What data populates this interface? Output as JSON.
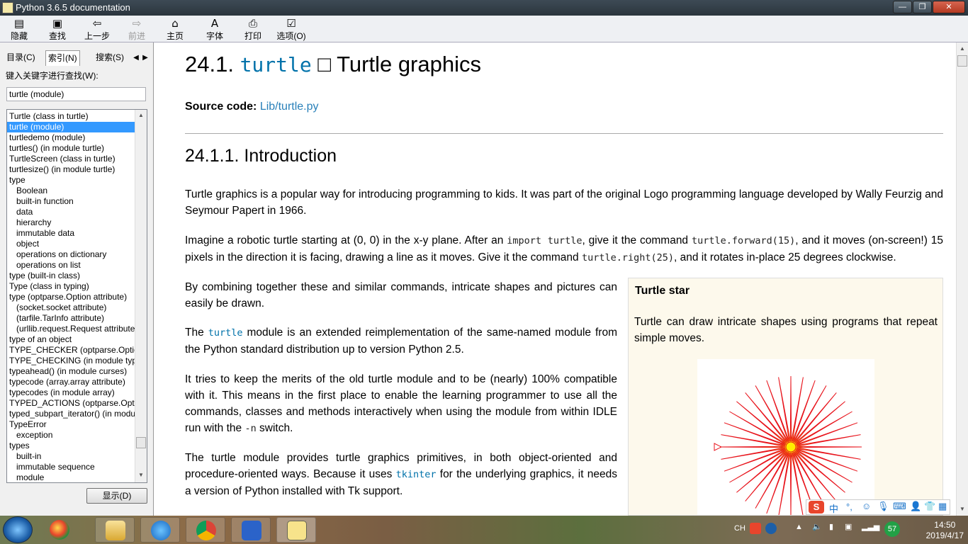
{
  "window": {
    "title": "Python 3.6.5 documentation",
    "min": "—",
    "max": "❐",
    "close": "✕"
  },
  "toolbar": {
    "hide": "隐藏",
    "find": "查找",
    "back": "上一步",
    "forward": "前进",
    "home": "主页",
    "font": "字体",
    "print": "打印",
    "options": "选项(O)"
  },
  "nav": {
    "tabs": [
      "目录(C)",
      "索引(N)",
      "搜索(S)"
    ],
    "keyword_label": "键入关键字进行查找(W):",
    "keyword_value": "turtle (module)",
    "show_button": "显示(D)",
    "index_items": [
      "Turtle (class in turtle)",
      "turtle (module)",
      "turtledemo (module)",
      "turtles() (in module turtle)",
      "TurtleScreen (class in turtle)",
      "turtlesize() (in module turtle)",
      "type",
      "Boolean",
      "built-in function",
      "data",
      "hierarchy",
      "immutable data",
      "object",
      "operations on dictionary",
      "operations on list",
      "type (built-in class)",
      "Type (class in typing)",
      "type (optparse.Option attribute)",
      "(socket.socket attribute)",
      "(tarfile.TarInfo attribute)",
      "(urllib.request.Request attribute)",
      "type of an object",
      "TYPE_CHECKER (optparse.Option attribute)",
      "TYPE_CHECKING (in module typing)",
      "typeahead() (in module curses)",
      "typecode (array.array attribute)",
      "typecodes (in module array)",
      "TYPED_ACTIONS (optparse.Option attribute)",
      "typed_subpart_iterator() (in module email.iterators)",
      "TypeError",
      "exception",
      "types",
      "built-in",
      "immutable sequence",
      "module"
    ]
  },
  "doc": {
    "h1_num": "24.1. ",
    "h1_code": "turtle",
    "h1_sep": " □ ",
    "h1_text": "Turtle graphics",
    "source_label": "Source code: ",
    "source_link": "Lib/turtle.py",
    "h2": "24.1.1. Introduction",
    "p1": "Turtle graphics is a popular way for introducing programming to kids. It was part of the original Logo programming language developed by Wally Feurzig and Seymour Papert in 1966.",
    "p2a": "Imagine a robotic turtle starting at (0, 0) in the x-y plane. After an ",
    "p2_code1": "import turtle",
    "p2b": ", give it the command ",
    "p2_code2": "turtle.forward(15)",
    "p2c": ", and it moves (on-screen!) 15 pixels in the direction it is facing, drawing a line as it moves. Give it the command ",
    "p2_code3": "turtle.right(25)",
    "p2d": ", and it rotates in-place 25 degrees clockwise.",
    "p3": "By combining together these and similar commands, intricate shapes and pictures can easily be drawn.",
    "p4a": "The ",
    "p4_code": "turtle",
    "p4b": " module is an extended reimplementation of the same-named module from the Python standard distribution up to version Python 2.5.",
    "p5a": "It tries to keep the merits of the old turtle module and to be (nearly) 100% compatible with it. This means in the first place to enable the learning programmer to use all the commands, classes and methods interactively when using the module from within IDLE run with the ",
    "p5_code": "-n",
    "p5b": " switch.",
    "p6a": "The turtle module provides turtle graphics primitives, in both object-oriented and procedure-oriented ways. Because it uses ",
    "p6_code": "tkinter",
    "p6b": " for the underlying graphics, it needs a version of Python installed with Tk support.",
    "sidebar_title": "Turtle star",
    "sidebar_text": "Turtle can draw intricate shapes using programs that repeat simple moves."
  },
  "star": {
    "rays": 36,
    "stroke": "#e8141c",
    "fill": "#ffef00",
    "center": "#ffef00"
  },
  "ime": {
    "logo": "S",
    "mode": "中"
  },
  "tray": {
    "lang": "CH",
    "badge": "57",
    "time": "14:50",
    "date": "2019/4/17"
  }
}
